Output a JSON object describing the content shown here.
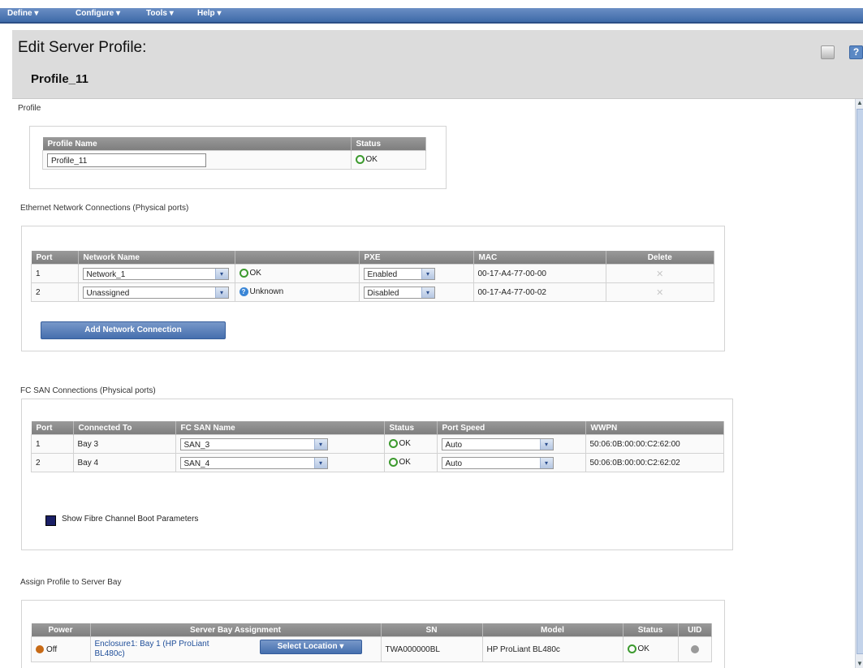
{
  "menu": {
    "define": "Define ▾",
    "configure": "Configure ▾",
    "tools": "Tools ▾",
    "help": "Help ▾"
  },
  "header": {
    "title": "Edit Server Profile:",
    "profile_name": "Profile_11",
    "help_icon": "?"
  },
  "profile_section": {
    "label": "Profile",
    "columns": [
      "Profile Name",
      "Status"
    ],
    "name_value": "Profile_11",
    "status": "OK"
  },
  "ethernet": {
    "label": "Ethernet Network Connections (Physical ports)",
    "columns": [
      "Port",
      "Network Name",
      "",
      "PXE",
      "MAC",
      "Delete"
    ],
    "rows": [
      {
        "port": "1",
        "network": "Network_1",
        "status": "OK",
        "status_icon": "ok",
        "pxe": "Enabled",
        "mac": "00-17-A4-77-00-00",
        "delete": "✕"
      },
      {
        "port": "2",
        "network": "Unassigned",
        "status": "Unknown",
        "status_icon": "unknown",
        "pxe": "Disabled",
        "mac": "00-17-A4-77-00-02",
        "delete": "✕"
      }
    ],
    "add_button": "Add Network Connection"
  },
  "fc_san": {
    "label": "FC SAN Connections (Physical ports)",
    "columns": [
      "Port",
      "Connected To",
      "FC SAN Name",
      "Status",
      "Port Speed",
      "WWPN"
    ],
    "rows": [
      {
        "port": "1",
        "connected_to": "Bay 3",
        "san": "SAN_3",
        "status": "OK",
        "speed": "Auto",
        "wwpn": "50:06:0B:00:00:C2:62:00"
      },
      {
        "port": "2",
        "connected_to": "Bay 4",
        "san": "SAN_4",
        "status": "OK",
        "speed": "Auto",
        "wwpn": "50:06:0B:00:00:C2:62:02"
      }
    ],
    "boot_params_label": "Show Fibre Channel Boot Parameters"
  },
  "assign": {
    "label": "Assign Profile to Server Bay",
    "columns": [
      "Power",
      "Server Bay Assignment",
      "SN",
      "Model",
      "Status",
      "UID"
    ],
    "row": {
      "power": "Off",
      "bay_link_line1": "Enclosure1: Bay 1 (HP ProLiant",
      "bay_link_line2": "BL480c)",
      "select_button": "Select Location ▾",
      "sn": "TWA000000BL",
      "model": "HP ProLiant BL480c",
      "status": "OK"
    }
  },
  "scrollbar": {
    "up": "▲",
    "down": "▼"
  },
  "icons": {
    "dropdown": "▾"
  },
  "colors": {
    "menubar": "#3e6aa8",
    "header_bg": "#dcdcdc",
    "table_header": "#8a8a8a",
    "ok_green": "#3c9a2e",
    "unknown_blue": "#3a86d6",
    "power_orange": "#c76a16",
    "boot_checkbox": "#1a1f66"
  }
}
